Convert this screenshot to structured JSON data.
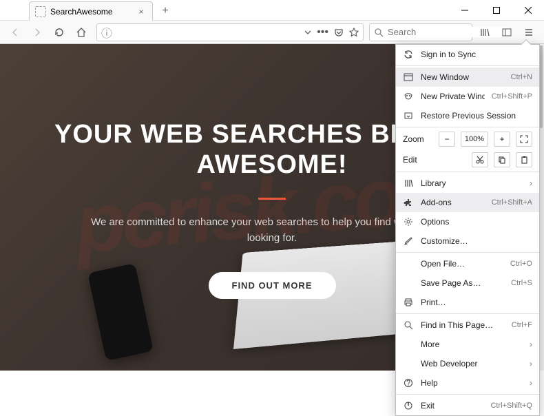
{
  "window": {
    "tab_title": "SearchAwesome"
  },
  "toolbar": {
    "search_placeholder": "Search"
  },
  "page": {
    "headline_line1": "YOUR WEB SEARCHES BECOME",
    "headline_line2": "AWESOME!",
    "subtext": "We are committed to enhance your web searches to help you find what you are looking for.",
    "cta_label": "FIND OUT MORE"
  },
  "menu": {
    "sign_in": "Sign in to Sync",
    "new_window": {
      "label": "New Window",
      "shortcut": "Ctrl+N"
    },
    "new_private": {
      "label": "New Private Window",
      "shortcut": "Ctrl+Shift+P"
    },
    "restore": "Restore Previous Session",
    "zoom_label": "Zoom",
    "zoom_value": "100%",
    "edit_label": "Edit",
    "library": "Library",
    "addons": {
      "label": "Add-ons",
      "shortcut": "Ctrl+Shift+A"
    },
    "options": "Options",
    "customize": "Customize…",
    "open_file": {
      "label": "Open File…",
      "shortcut": "Ctrl+O"
    },
    "save_page": {
      "label": "Save Page As…",
      "shortcut": "Ctrl+S"
    },
    "print": "Print…",
    "find": {
      "label": "Find in This Page…",
      "shortcut": "Ctrl+F"
    },
    "more": "More",
    "web_dev": "Web Developer",
    "help": "Help",
    "exit": {
      "label": "Exit",
      "shortcut": "Ctrl+Shift+Q"
    }
  }
}
